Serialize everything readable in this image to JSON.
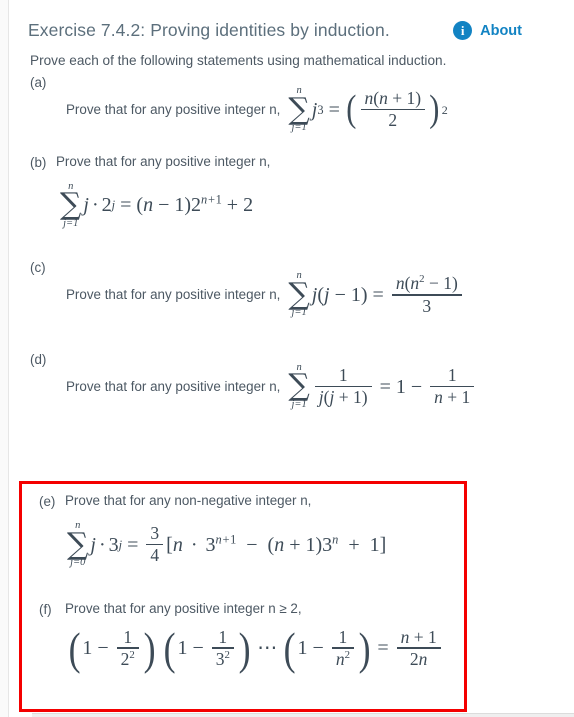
{
  "header": {
    "title": "Exercise 7.4.2: Proving identities by induction.",
    "about_label": "About",
    "info_icon": "info-circle-icon",
    "accent_color": "#1283c3",
    "title_color": "#5c6f7c"
  },
  "intro": "Prove each of the following statements using mathematical induction.",
  "highlight": {
    "color": "#f40000",
    "covers": [
      "e",
      "f"
    ]
  },
  "parts": [
    {
      "id": "a",
      "label": "(a)",
      "statement": "Prove that for any positive integer n,",
      "layout": "inline",
      "formula_tex": "\\sum_{j=1}^{n} j^3 = \\left(\\frac{n(n+1)}{2}\\right)^2",
      "sum_lower": "j=1",
      "sum_upper": "n"
    },
    {
      "id": "b",
      "label": "(b)",
      "statement": "Prove that for any positive integer n,",
      "layout": "block",
      "formula_tex": "\\sum_{j=1}^{n} j \\cdot 2^j = (n-1)2^{n+1} + 2",
      "sum_lower": "j=1",
      "sum_upper": "n"
    },
    {
      "id": "c",
      "label": "(c)",
      "statement": "Prove that for any positive integer n,",
      "layout": "inline",
      "formula_tex": "\\sum_{j=1}^{n} j(j-1) = \\frac{n(n^2-1)}{3}",
      "sum_lower": "j=1",
      "sum_upper": "n"
    },
    {
      "id": "d",
      "label": "(d)",
      "statement": "Prove that for any positive integer n,",
      "layout": "inline",
      "formula_tex": "\\sum_{j=1}^{n} \\frac{1}{j(j+1)} = 1 - \\frac{1}{n+1}",
      "sum_lower": "j=1",
      "sum_upper": "n"
    },
    {
      "id": "e",
      "label": "(e)",
      "statement": "Prove that for any non-negative integer n,",
      "layout": "block",
      "formula_tex": "\\sum_{j=0}^{n} j \\cdot 3^j = \\frac{3}{4}[n \\cdot 3^{n+1} - (n+1)3^n + 1]",
      "sum_lower": "j=0",
      "sum_upper": "n"
    },
    {
      "id": "f",
      "label": "(f)",
      "statement": "Prove that for any positive integer n ≥ 2,",
      "layout": "block",
      "formula_tex": "\\left(1-\\frac{1}{2^2}\\right)\\left(1-\\frac{1}{3^2}\\right)\\cdots\\left(1-\\frac{1}{n^2}\\right) = \\frac{n+1}{2n}"
    }
  ],
  "math_tokens": {
    "sigma": "∑",
    "equals": "=",
    "minus": "−",
    "plus": "+",
    "cdot": "·",
    "ldots": "⋯",
    "lparen": "(",
    "rparen": ")",
    "lbrack": "[",
    "rbrack": "]",
    "j": "j",
    "n": "n",
    "one": "1",
    "two": "2",
    "three": "3",
    "four": "4",
    "j_eq_1": "j=1",
    "j_eq_0": "j=0"
  }
}
